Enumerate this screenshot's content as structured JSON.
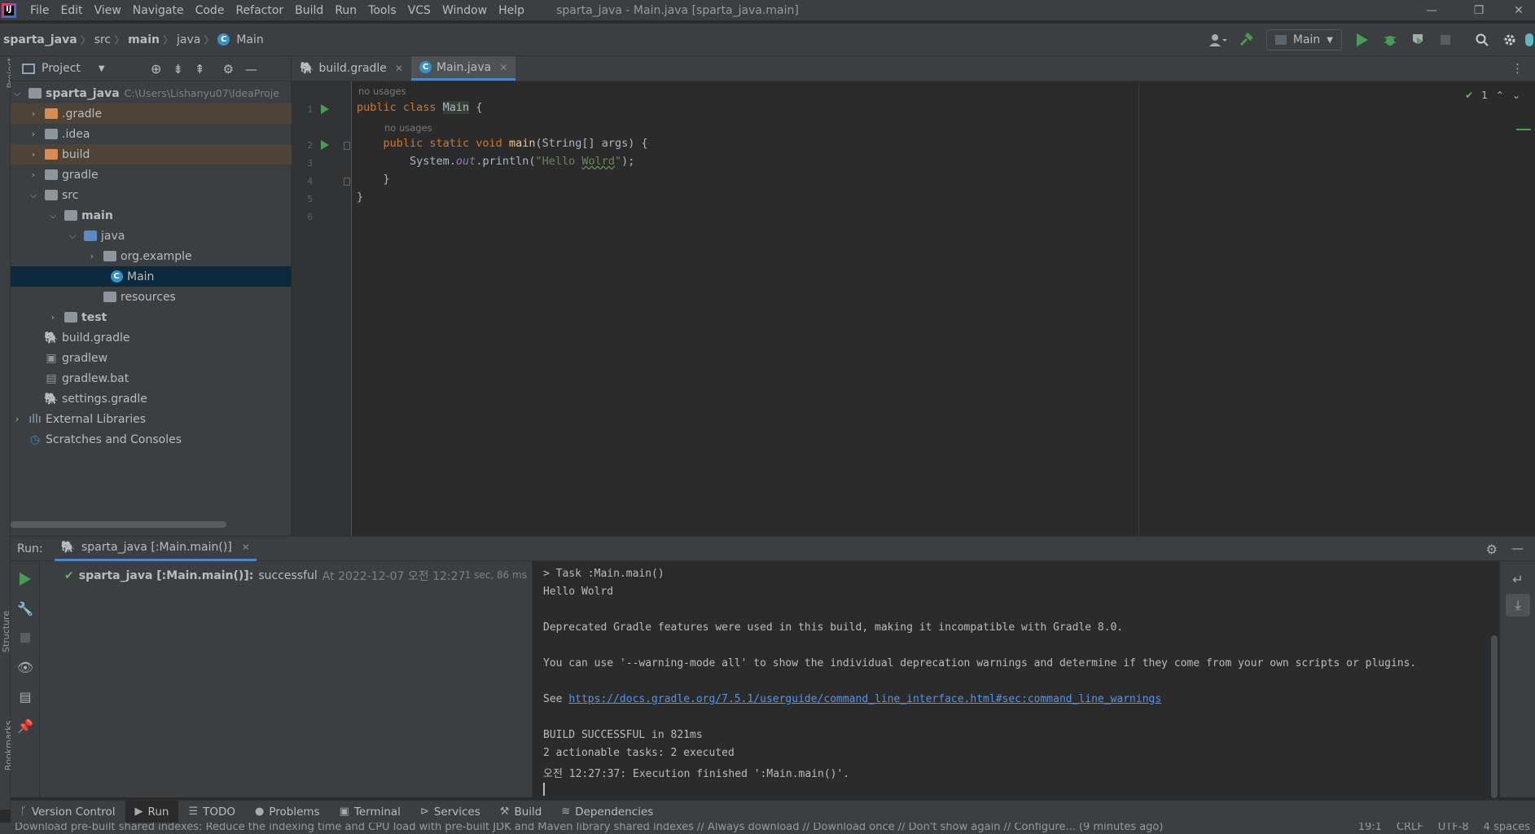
{
  "menu": {
    "items": [
      "File",
      "Edit",
      "View",
      "Navigate",
      "Code",
      "Refactor",
      "Build",
      "Run",
      "Tools",
      "VCS",
      "Window",
      "Help"
    ],
    "window_title": "sparta_java - Main.java [sparta_java.main]"
  },
  "breadcrumb": [
    "sparta_java",
    "src",
    "main",
    "java",
    "Main"
  ],
  "run_config": "Main",
  "project_panel": {
    "title": "Project",
    "root_name": "sparta_java",
    "root_path": "C:\\Users\\Lishanyu07\\IdeaProje",
    "items": [
      ".gradle",
      ".idea",
      "build",
      "gradle",
      "src",
      "main",
      "java",
      "org.example",
      "Main",
      "resources",
      "test",
      "build.gradle",
      "gradlew",
      "gradlew.bat",
      "settings.gradle",
      "External Libraries",
      "Scratches and Consoles"
    ]
  },
  "editor_tabs": [
    "build.gradle",
    "Main.java"
  ],
  "editor": {
    "line_numbers": [
      "1",
      "2",
      "3",
      "4",
      "5",
      "6"
    ],
    "usage_hint": "no usages",
    "code": {
      "l1_kw": "public class ",
      "l1_cls": "Main",
      "l1_end": " {",
      "l2_kw": "    public static void ",
      "l2_fn": "main",
      "l2_end": "(String[] args) {",
      "l3_a": "        System.",
      "l3_fld": "out",
      "l3_b": ".println(",
      "l3_str1": "\"Hello ",
      "l3_str2": "Wolrd",
      "l3_str3": "\"",
      "l3_end": ");",
      "l4": "    }",
      "l5": "}"
    },
    "inspection_count": "1"
  },
  "run_panel": {
    "label": "Run:",
    "tab": "sparta_java [:Main.main()]",
    "build_name": "sparta_java [:Main.main()]:",
    "build_status": "successful",
    "build_at": "At 2022-12-07 오전 12:27",
    "build_time": "1 sec, 86 ms"
  },
  "console": {
    "task": "> Task :Main.main()",
    "output": "Hello Wolrd",
    "deprecated": "Deprecated Gradle features were used in this build, making it incompatible with Gradle 8.0.",
    "warning_mode": "You can use '--warning-mode all' to show the individual deprecation warnings and determine if they come from your own scripts or plugins.",
    "see": "See ",
    "link": "https://docs.gradle.org/7.5.1/userguide/command_line_interface.html#sec:command_line_warnings",
    "build_success": "BUILD SUCCESSFUL in 821ms",
    "tasks": "2 actionable tasks: 2 executed",
    "finished": "오전 12:27:37: Execution finished ':Main.main()'."
  },
  "tool_tabs": [
    "Version Control",
    "Run",
    "TODO",
    "Problems",
    "Terminal",
    "Services",
    "Build",
    "Dependencies"
  ],
  "left_strip": [
    "Project",
    "Structure",
    "Bookmarks"
  ],
  "status": {
    "message": "Download pre-built shared indexes: Reduce the indexing time and CPU load with pre-built JDK and Maven library shared indexes // Always download // Download once // Don't show again // Configure... (9 minutes ago)",
    "position": "19:1",
    "line_sep": "CRLF",
    "encoding": "UTF-8",
    "indent": "4 spaces"
  }
}
